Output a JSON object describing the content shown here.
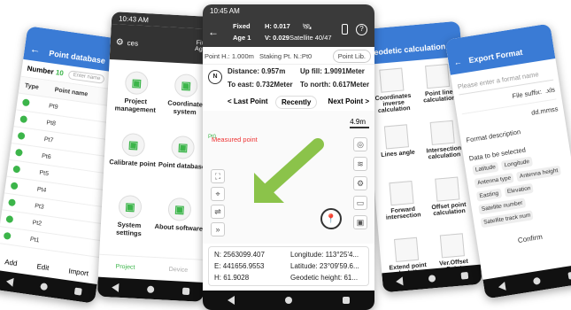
{
  "p1": {
    "time": "10:44 AM",
    "title": "Point database",
    "number_label": "Number",
    "number_value": "10",
    "search_ph": "Enter name",
    "col_type": "Type",
    "col_name": "Point name",
    "points": [
      "Pt9",
      "Pt8",
      "Pt7",
      "Pt6",
      "Pt5",
      "Pt4",
      "Pt3",
      "Pt2",
      "Pt1"
    ],
    "btn_add": "Add",
    "btn_edit": "Edit",
    "btn_import": "Import"
  },
  "p2": {
    "time": "10:43 AM",
    "hdr": "ces",
    "fixed": "Fixed",
    "age": "Age 1",
    "tiles": [
      "Project management",
      "Coordinate system",
      "Calibrate point",
      "Point database",
      "System settings",
      "About software"
    ],
    "tab_project": "Project",
    "tab_device": "Device"
  },
  "p3": {
    "time": "10:45 AM",
    "fixed": "Fixed",
    "age": "Age 1",
    "h": "H: 0.017",
    "v": "V: 0.029",
    "sat": "Satellite 40/47",
    "point_h": "Point H.: 1.000m",
    "staking": "Staking Pt. N.:Pt0",
    "pointlib": "Point Lib.",
    "distance": "Distance: 0.957m",
    "upfill": "Up fill: 1.9091Meter",
    "east": "To east: 0.732Meter",
    "north": "To north: 0.617Meter",
    "last": "< Last Point",
    "recently": "Recently",
    "next": "Next Point >",
    "scale": "4.9m",
    "measured": "Measured point",
    "pt": "Pt0",
    "n": "N: 2563099.407",
    "e": "E: 441656.9553",
    "hh": "H: 61.9028",
    "lon": "Longitude: 113°25'4...",
    "lat": "Latitude: 23°09'59.6...",
    "geo": "Geodetic height: 61...",
    "compass": "N"
  },
  "p4": {
    "title": "Geodetic calculation",
    "tiles": [
      "Coordinates inverse calculation",
      "Point line calculation",
      "Lines angle",
      "Intersection calculation",
      "Forward intersection",
      "Offset point calculation",
      "Extend point calculation",
      "Ver.Offset Point Calculation"
    ]
  },
  "p5": {
    "title": "Export Format",
    "name_ph": "Please enter a format name",
    "suffix_label": "File suffix:",
    "suffix": ".xls",
    "angle": "dd.mmss",
    "desc": "Format description",
    "sel": "Data to be selected",
    "chips": [
      "Latitude",
      "Longitude",
      "Antenna type",
      "Antenna height",
      "Easting",
      "Elevation",
      "Satellite number",
      "Satellite track num"
    ],
    "confirm": "Confirm"
  }
}
